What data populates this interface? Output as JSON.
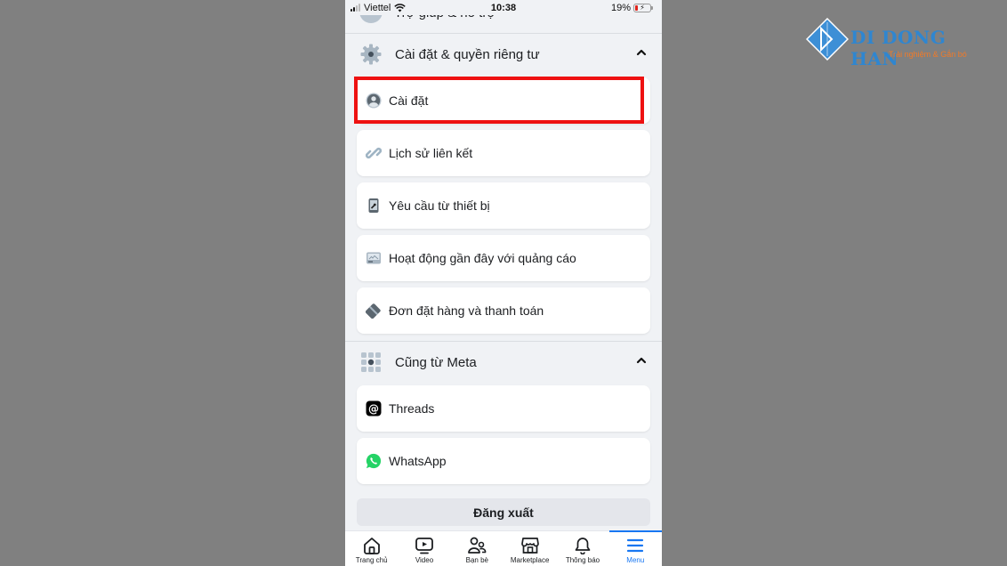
{
  "status_bar": {
    "carrier": "Viettel",
    "time": "10:38",
    "battery": "19%"
  },
  "help_row": {
    "label": "Trợ giúp & hỗ trợ"
  },
  "settings_section": {
    "title": "Cài đặt & quyền riêng tư",
    "items": [
      {
        "label": "Cài đặt",
        "icon": "profile-settings-icon",
        "highlighted": true
      },
      {
        "label": "Lịch sử liên kết",
        "icon": "link-icon"
      },
      {
        "label": "Yêu cầu từ thiết bị",
        "icon": "device-request-icon"
      },
      {
        "label": "Hoạt động gần đây với quảng cáo",
        "icon": "ad-activity-icon"
      },
      {
        "label": "Đơn đặt hàng và thanh toán",
        "icon": "payment-card-icon"
      }
    ]
  },
  "meta_section": {
    "title": "Cũng từ Meta",
    "items": [
      {
        "label": "Threads",
        "icon": "threads-icon"
      },
      {
        "label": "WhatsApp",
        "icon": "whatsapp-icon"
      }
    ]
  },
  "logout_label": "Đăng xuất",
  "tabbar": {
    "tabs": [
      {
        "label": "Trang chủ",
        "icon": "home-icon"
      },
      {
        "label": "Video",
        "icon": "video-icon"
      },
      {
        "label": "Bạn bè",
        "icon": "friends-icon"
      },
      {
        "label": "Marketplace",
        "icon": "marketplace-icon"
      },
      {
        "label": "Thông báo",
        "icon": "bell-icon"
      },
      {
        "label": "Menu",
        "icon": "menu-icon",
        "active": true
      }
    ]
  },
  "watermark": {
    "brand": "DI DONG HAN",
    "tagline": "Trải nghiệm & Gắn bó"
  },
  "colors": {
    "highlight": "#ee1111",
    "accent": "#1877f2",
    "page_bg": "#f0f2f5",
    "outer_bg": "#808080"
  }
}
